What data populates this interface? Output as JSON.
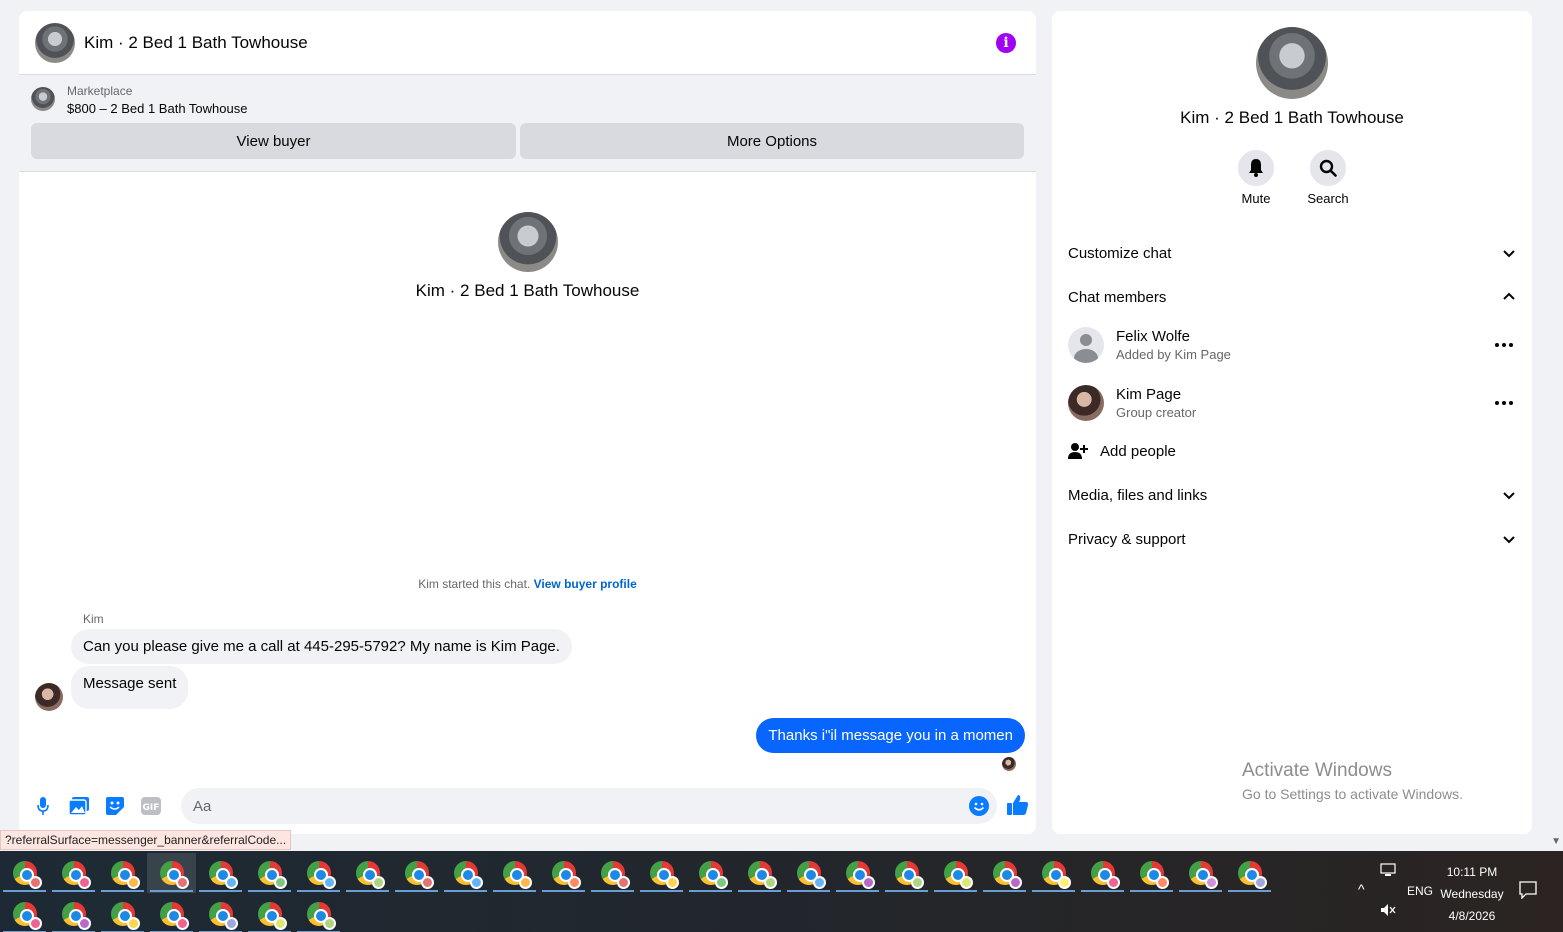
{
  "chat": {
    "title": "Kim · 2 Bed 1 Bath Towhouse",
    "banner": {
      "category": "Marketplace",
      "listing": "$800 – 2 Bed 1 Bath Towhouse",
      "view_buyer": "View buyer",
      "more_options": "More Options"
    },
    "intro_title": "Kim · 2 Bed 1 Bath Towhouse",
    "system_text": "Kim started this chat.",
    "system_link": "View buyer profile",
    "sender": "Kim",
    "messages_in": [
      "Can you please give me a call at 445-295-5792? My name is Kim Page.",
      "Message sent"
    ],
    "message_out": "Thanks i\"il message you in a momen",
    "composer_placeholder": "Aa"
  },
  "status_url": "?referralSurface=messenger_banner&referralCode...",
  "side": {
    "title": "Kim · 2 Bed 1 Bath Towhouse",
    "mute": "Mute",
    "search": "Search",
    "customize": "Customize chat",
    "members_header": "Chat members",
    "members": [
      {
        "name": "Felix Wolfe",
        "sub": "Added by Kim Page"
      },
      {
        "name": "Kim Page",
        "sub": "Group creator"
      }
    ],
    "add_people": "Add people",
    "media": "Media, files and links",
    "privacy": "Privacy & support"
  },
  "watermark": {
    "line1": "Activate Windows",
    "line2": "Go to Settings to activate Windows."
  },
  "taskbar": {
    "time": "10:11 PM",
    "day": "Wednesday",
    "date": "4/8/2026",
    "lang": "ENG",
    "row1_profile_colors": [
      "#e57373",
      "#f06292",
      "#ffb74d",
      "#e57373",
      "#64b5f6",
      "#81c784",
      "#64b5f6",
      "#aed581",
      "#e57373",
      "#64b5f6",
      "#ffb74d",
      "#ff8a65",
      "#e57373",
      "#ffd54f",
      "#81c784",
      "#aed581",
      "#64b5f6",
      "#ba68c8",
      "#aed581",
      "#dce775",
      "#ba68c8",
      "#fff176",
      "#f06292",
      "#ff8a65",
      "#ce93d8",
      "#9fa8da"
    ],
    "row2_profile_colors": [
      "#f06292",
      "#ba68c8",
      "#ffd54f",
      "#f06292",
      "#9fa8da",
      "#dce775",
      "#aed581"
    ]
  },
  "colors": {
    "accent_blue": "#0866ff",
    "info_purple": "#a100f2",
    "icon_blue": "#0a7cff"
  }
}
